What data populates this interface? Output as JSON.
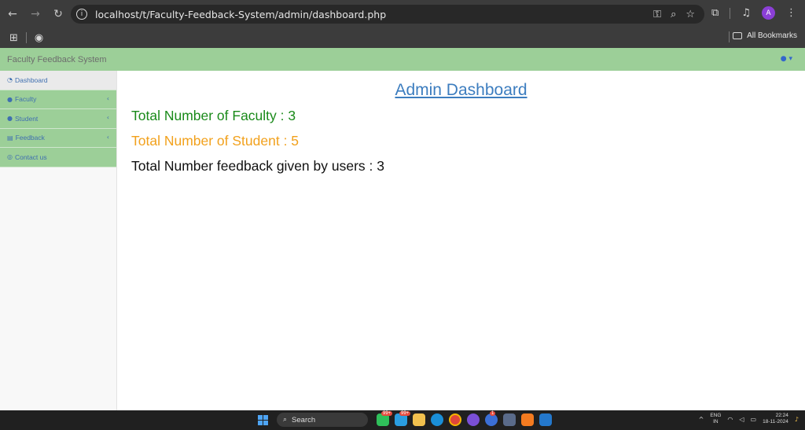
{
  "browser": {
    "url": "localhost/t/Faculty-Feedback-System/admin/dashboard.php",
    "nav_icons": [
      "back-arrow-icon",
      "forward-arrow-icon",
      "reload-icon"
    ],
    "profile_initial": "A",
    "all_bookmarks_label": "All Bookmarks"
  },
  "app": {
    "brand": "Faculty Feedback System",
    "user_menu_icon": "user-icon"
  },
  "sidebar": {
    "items": [
      {
        "label": "Dashboard",
        "icon": "dashboard-icon",
        "active": true,
        "has_chevron": false
      },
      {
        "label": "Faculty",
        "icon": "user-icon",
        "active": false,
        "has_chevron": true
      },
      {
        "label": "Student",
        "icon": "user-icon",
        "active": false,
        "has_chevron": true
      },
      {
        "label": "Feedback",
        "icon": "book-icon",
        "active": false,
        "has_chevron": true
      },
      {
        "label": "Contact us",
        "icon": "eye-icon",
        "active": false,
        "has_chevron": false
      }
    ]
  },
  "main": {
    "title": "Admin Dashboard",
    "stats": {
      "faculty": "Total Number of Faculty : 3",
      "student": "Total Number of Student : 5",
      "feedback": "Total Number feedback given by users : 3"
    }
  },
  "colors": {
    "header_green": "#9ccf98",
    "faculty_text": "#1a8a1a",
    "student_text": "#f2a11c",
    "link_blue": "#3c7dbf"
  },
  "taskbar": {
    "search_label": "Search",
    "badge_1": "99+",
    "badge_2": "99+",
    "badge_3": "1",
    "lang_top": "ENG",
    "lang_bottom": "IN",
    "time": "22:24",
    "date": "18-11-2024"
  }
}
